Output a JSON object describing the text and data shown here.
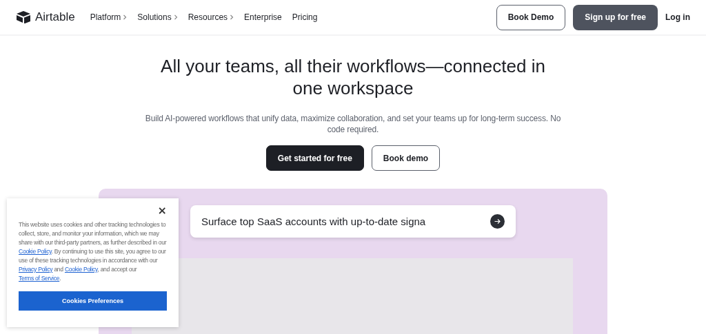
{
  "header": {
    "logo": "Airtable",
    "nav": [
      {
        "label": "Platform",
        "has_menu": true
      },
      {
        "label": "Solutions",
        "has_menu": true
      },
      {
        "label": "Resources",
        "has_menu": true
      },
      {
        "label": "Enterprise",
        "has_menu": false
      },
      {
        "label": "Pricing",
        "has_menu": false
      }
    ],
    "book_demo": "Book Demo",
    "sign_up": "Sign up for free",
    "log_in": "Log in"
  },
  "hero": {
    "title": "All your teams, all their workflows—connected in one workspace",
    "subtitle": "Build AI-powered workflows that unify data, maximize collaboration, and set your teams up for long-term success. No code required.",
    "primary_button": "Get started for free",
    "secondary_button": "Book demo"
  },
  "demo": {
    "prompt": "Surface top SaaS accounts with up-to-date signa"
  },
  "cookie_banner": {
    "close": "×",
    "text": [
      {
        "kind": "text",
        "text": "This website uses cookies and other tracking technologies to collect, store, and monitor your information, which we may share with our third-party partners, as further described in our "
      },
      {
        "kind": "link",
        "text": "Cookie Policy"
      },
      {
        "kind": "text",
        "text": ". By continuing to use this site, you agree to our use of these tracking technologies in accordance with our "
      },
      {
        "kind": "link",
        "text": "Privacy Policy"
      },
      {
        "kind": "text",
        "text": " and "
      },
      {
        "kind": "link",
        "text": "Cookie Policy"
      },
      {
        "kind": "text",
        "text": ", and accept our "
      },
      {
        "kind": "link",
        "text": "Terms of Service"
      },
      {
        "kind": "text",
        "text": "."
      }
    ],
    "button": "Cookies Preferences"
  }
}
